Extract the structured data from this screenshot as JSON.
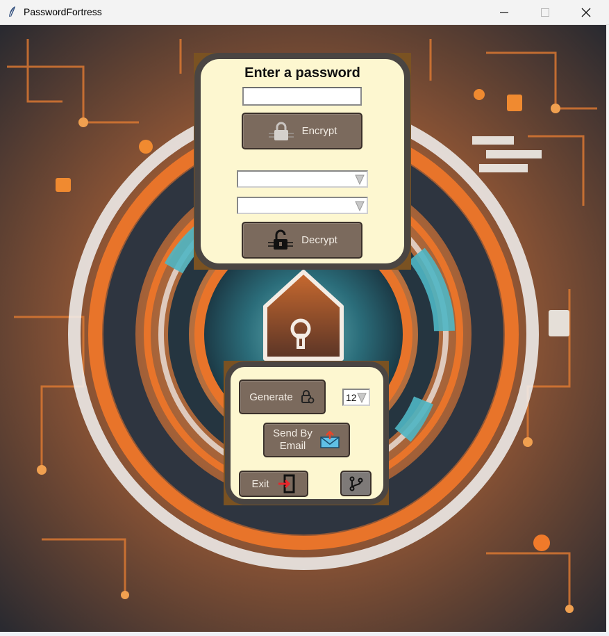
{
  "window": {
    "title": "PasswordFortress",
    "minimize_icon": "minimize-icon",
    "maximize_icon": "maximize-icon",
    "close_icon": "close-icon"
  },
  "encrypt_panel": {
    "heading": "Enter a password",
    "password_value": "",
    "encrypt_label": "Encrypt",
    "encrypt_icon": "padlock-closed-icon"
  },
  "decrypt_panel": {
    "combo1_value": "",
    "combo2_value": "",
    "decrypt_label": "Decrypt",
    "decrypt_icon": "padlock-open-icon"
  },
  "tools_panel": {
    "generate_label": "Generate",
    "generate_icon": "lock-gear-icon",
    "length_value": "12",
    "email_label_line1": "Send By",
    "email_label_line2": "Email",
    "email_icon": "envelope-upload-icon",
    "exit_label": "Exit",
    "exit_icon": "exit-door-icon",
    "git_icon": "git-branch-icon"
  },
  "colors": {
    "panel_bg": "#fdf7d0",
    "panel_border": "#4a4542",
    "button_bg": "#7b6a5d",
    "accent_orange": "#e8742a"
  }
}
